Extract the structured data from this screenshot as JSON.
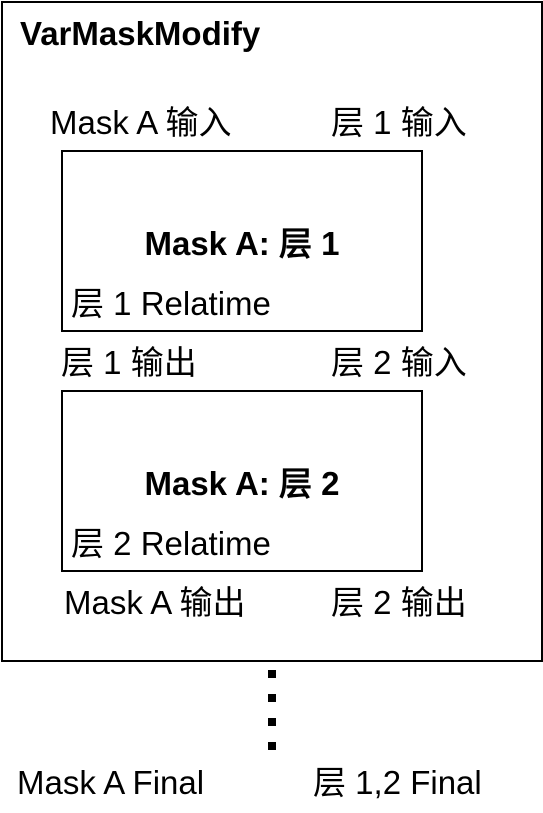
{
  "diagram": {
    "title": "VarMaskModify",
    "top_labels": {
      "left": "Mask A 输入",
      "right": "层 1 输入"
    },
    "layer1": {
      "title": "Mask A: 层 1",
      "subtitle": "层 1 Relatime"
    },
    "middle_labels": {
      "left": "层 1 输出",
      "right": "层 2 输入"
    },
    "layer2": {
      "title": "Mask A: 层 2",
      "subtitle": "层 2 Relatime"
    },
    "bottom_labels": {
      "left": "Mask A 输出",
      "right": "层 2 输出"
    },
    "final_labels": {
      "left": "Mask A Final",
      "right": "层 1,2 Final"
    }
  }
}
